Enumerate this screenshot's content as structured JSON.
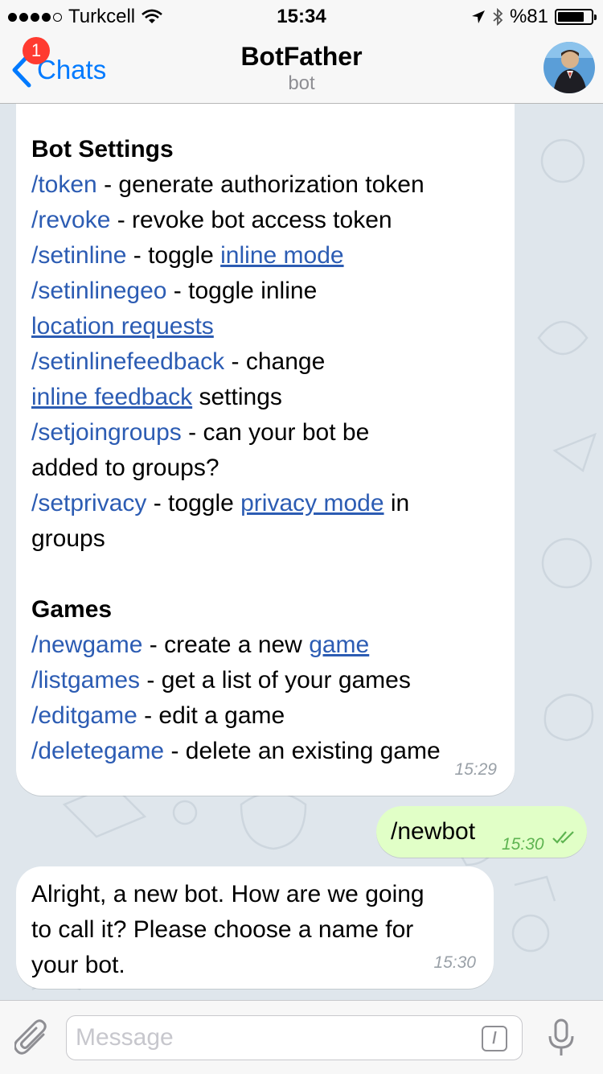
{
  "status_bar": {
    "carrier": "Turkcell",
    "time": "15:34",
    "battery": "%81",
    "battery_level": 0.81
  },
  "nav": {
    "back_label": "Chats",
    "unread_count": "1",
    "title": "BotFather",
    "subtitle": "bot"
  },
  "messages": {
    "settings": {
      "heading": "Bot Settings",
      "token_cmd": "/token",
      "token_desc": " - generate authorization token",
      "revoke_cmd": "/revoke",
      "revoke_desc": " - revoke bot access token",
      "setinline_cmd": "/setinline",
      "setinline_desc": " - toggle ",
      "setinline_link": "inline mode",
      "setinlinegeo_cmd": "/setinlinegeo",
      "setinlinegeo_desc": " - toggle inline",
      "setinlinegeo_link": "location requests",
      "setinlinefeedback_cmd": "/setinlinefeedback",
      "setinlinefeedback_desc": " - change",
      "setinlinefeedback_link": "inline feedback",
      "setinlinefeedback_tail": " settings",
      "setjoingroups_cmd": "/setjoingroups",
      "setjoingroups_desc": " - can your bot be",
      "setjoingroups_tail": "added to groups?",
      "setprivacy_cmd": "/setprivacy",
      "setprivacy_desc": " - toggle ",
      "setprivacy_link": "privacy mode",
      "setprivacy_tail1": " in",
      "setprivacy_tail2": "groups"
    },
    "games": {
      "heading": "Games",
      "newgame_cmd": "/newgame",
      "newgame_desc": " - create a new ",
      "newgame_link": "game",
      "listgames_cmd": "/listgames",
      "listgames_desc": " - get a list of your games",
      "editgame_cmd": "/editgame",
      "editgame_desc": " - edit a game",
      "deletegame_cmd": "/deletegame",
      "deletegame_desc": " - delete an existing game"
    },
    "first_time": "15:29",
    "outgoing": {
      "text": "/newbot",
      "time": "15:30"
    },
    "reply": {
      "line1": "Alright, a new bot. How are we going",
      "line2": "to call it? Please choose a name for",
      "line3": "your bot.",
      "time": "15:30"
    }
  },
  "input": {
    "placeholder": "Message",
    "command_symbol": "/"
  },
  "colors": {
    "accent": "#007aff",
    "link": "#2c5cb3",
    "outgoing_bubble": "#e1ffc7",
    "badge": "#ff3b30"
  },
  "icons": [
    "signal-dots-icon",
    "wifi-icon",
    "location-arrow-icon",
    "bluetooth-icon",
    "battery-icon",
    "chevron-left-icon",
    "paperclip-icon",
    "command-icon",
    "microphone-icon",
    "double-check-icon"
  ]
}
